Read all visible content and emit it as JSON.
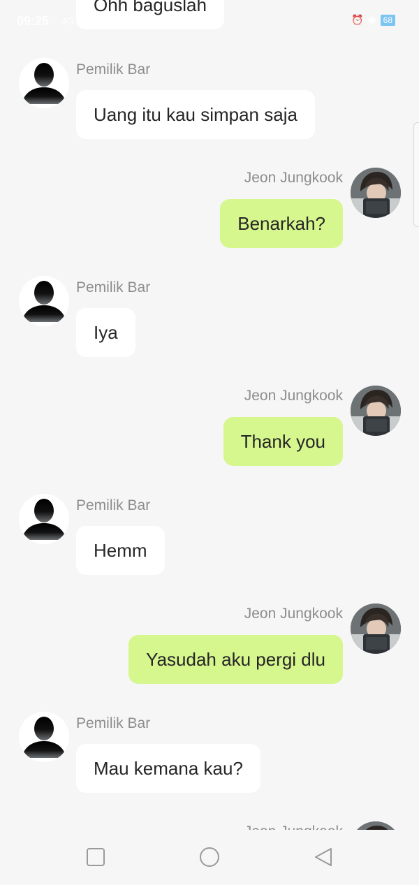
{
  "status_bar": {
    "time": "09:25",
    "signal": "4G",
    "battery": "68",
    "icons": [
      "alarm-icon",
      "eye-icon"
    ]
  },
  "contacts": {
    "owner": "Pemilik Bar",
    "me": "Jeon Jungkook"
  },
  "top_partial_message": "Ohh baguslah",
  "messages": [
    {
      "sender": "Pemilik Bar",
      "side": "left",
      "text": "Uang itu kau simpan saja"
    },
    {
      "sender": "Jeon Jungkook",
      "side": "right",
      "text": "Benarkah?"
    },
    {
      "sender": "Pemilik Bar",
      "side": "left",
      "text": "Iya"
    },
    {
      "sender": "Jeon Jungkook",
      "side": "right",
      "text": "Thank you"
    },
    {
      "sender": "Pemilik Bar",
      "side": "left",
      "text": "Hemm"
    },
    {
      "sender": "Jeon Jungkook",
      "side": "right",
      "text": "Yasudah aku pergi dlu"
    },
    {
      "sender": "Pemilik Bar",
      "side": "left",
      "text": "Mau kemana kau?"
    },
    {
      "sender": "Jeon Jungkook",
      "side": "right",
      "text": ""
    }
  ],
  "nav": {
    "recent_icon": "square-icon",
    "home_icon": "circle-icon",
    "back_icon": "triangle-back-icon"
  },
  "colors": {
    "background": "#f6f6f6",
    "incoming_bubble": "#ffffff",
    "outgoing_bubble": "#d6f68e",
    "name_text": "#8d8d8d",
    "message_text": "#262626"
  }
}
